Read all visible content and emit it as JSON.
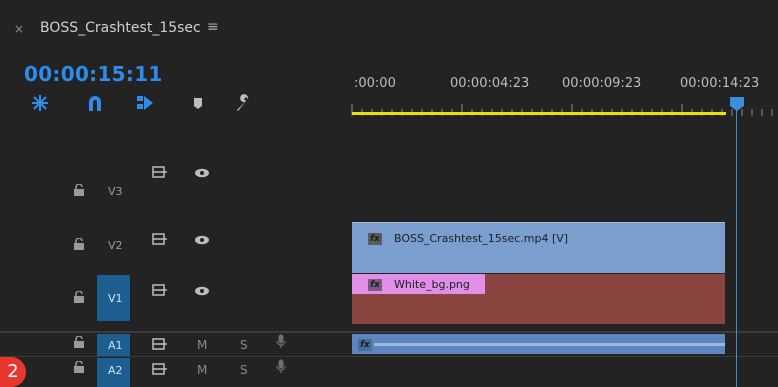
{
  "tab": {
    "close_glyph": "×",
    "title": "BOSS_Crashtest_15sec",
    "menu_glyph": "≡"
  },
  "timecode": "00:00:15:11",
  "tools": [
    "snap-icon",
    "linked-selection-icon",
    "insert-overwrite-icon",
    "add-marker-icon",
    "wrench-icon"
  ],
  "ruler": {
    "labels": [
      ":00:00",
      "00:00:04:23",
      "00:00:09:23",
      "00:00:14:23"
    ]
  },
  "tracks": [
    {
      "name": "V3",
      "type": "video",
      "selected": false
    },
    {
      "name": "V2",
      "type": "video",
      "selected": false
    },
    {
      "name": "V1",
      "type": "video",
      "selected": true
    },
    {
      "name": "A1",
      "type": "audio",
      "selected": true,
      "mute": "M",
      "solo": "S"
    },
    {
      "name": "A2",
      "type": "audio",
      "selected": true,
      "mute": "M",
      "solo": "S"
    }
  ],
  "clips": {
    "v2": {
      "label": "BOSS_Crashtest_15sec.mp4 [V]",
      "fx": "fx",
      "color": "#7a9fcf"
    },
    "v1": {
      "label": "White_bg.png",
      "fx": "fx",
      "color": "#8a4540",
      "label_bg": "#e08ee6"
    },
    "a1": {
      "fx": "fx",
      "color": "#5e86be"
    }
  },
  "badge": "2",
  "colors": {
    "accent": "#2d8ceb",
    "workarea": "#e5e110",
    "selected_track": "#1b5e8f"
  }
}
